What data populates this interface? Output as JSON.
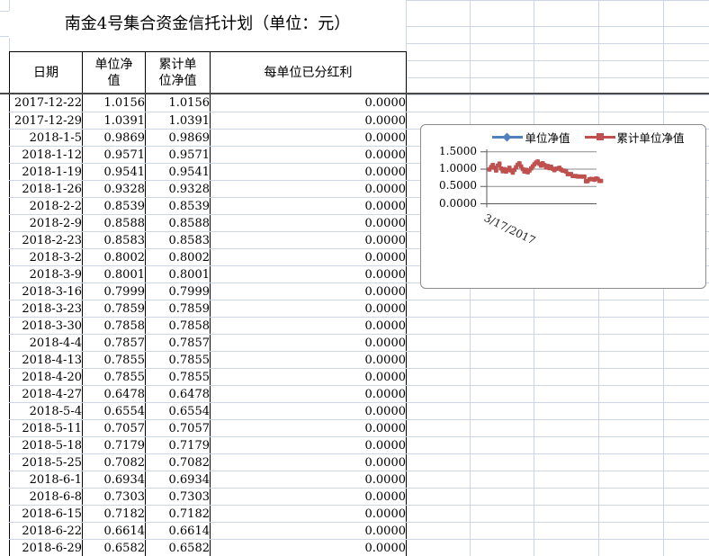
{
  "sheet": {
    "title": "南金4号集合资金信托计划（单位：元）",
    "columns": [
      "日期",
      "单位净\n值",
      "累计单\n位净值",
      "每单位已分红利"
    ],
    "rows": [
      [
        "2017-12-22",
        "1.0156",
        "1.0156",
        "0.0000"
      ],
      [
        "2017-12-29",
        "1.0391",
        "1.0391",
        "0.0000"
      ],
      [
        "2018-1-5",
        "0.9869",
        "0.9869",
        "0.0000"
      ],
      [
        "2018-1-12",
        "0.9571",
        "0.9571",
        "0.0000"
      ],
      [
        "2018-1-19",
        "0.9541",
        "0.9541",
        "0.0000"
      ],
      [
        "2018-1-26",
        "0.9328",
        "0.9328",
        "0.0000"
      ],
      [
        "2018-2-2",
        "0.8539",
        "0.8539",
        "0.0000"
      ],
      [
        "2018-2-9",
        "0.8588",
        "0.8588",
        "0.0000"
      ],
      [
        "2018-2-23",
        "0.8583",
        "0.8583",
        "0.0000"
      ],
      [
        "2018-3-2",
        "0.8002",
        "0.8002",
        "0.0000"
      ],
      [
        "2018-3-9",
        "0.8001",
        "0.8001",
        "0.0000"
      ],
      [
        "2018-3-16",
        "0.7999",
        "0.7999",
        "0.0000"
      ],
      [
        "2018-3-23",
        "0.7859",
        "0.7859",
        "0.0000"
      ],
      [
        "2018-3-30",
        "0.7858",
        "0.7858",
        "0.0000"
      ],
      [
        "2018-4-4",
        "0.7857",
        "0.7857",
        "0.0000"
      ],
      [
        "2018-4-13",
        "0.7855",
        "0.7855",
        "0.0000"
      ],
      [
        "2018-4-20",
        "0.7855",
        "0.7855",
        "0.0000"
      ],
      [
        "2018-4-27",
        "0.6478",
        "0.6478",
        "0.0000"
      ],
      [
        "2018-5-4",
        "0.6554",
        "0.6554",
        "0.0000"
      ],
      [
        "2018-5-11",
        "0.7057",
        "0.7057",
        "0.0000"
      ],
      [
        "2018-5-18",
        "0.7179",
        "0.7179",
        "0.0000"
      ],
      [
        "2018-5-25",
        "0.7082",
        "0.7082",
        "0.0000"
      ],
      [
        "2018-6-1",
        "0.6934",
        "0.6934",
        "0.0000"
      ],
      [
        "2018-6-8",
        "0.7303",
        "0.7303",
        "0.0000"
      ],
      [
        "2018-6-15",
        "0.7182",
        "0.7182",
        "0.0000"
      ],
      [
        "2018-6-22",
        "0.6614",
        "0.6614",
        "0.0000"
      ],
      [
        "2018-6-29",
        "0.6582",
        "0.6582",
        "0.0000"
      ]
    ]
  },
  "chart": {
    "legend": [
      {
        "label": "单位净值"
      },
      {
        "label": "累计单位净值"
      }
    ],
    "y_tick_labels": [
      "1.5000",
      "1.0000",
      "0.5000",
      "0.0000"
    ],
    "x_tick_label": "3/17/2017"
  },
  "chart_data": {
    "type": "line",
    "x_start_label": "3/17/2017",
    "x_frequency": "weekly",
    "ylim": [
      0,
      1.5
    ],
    "y_ticks": [
      0.0,
      0.5,
      1.0,
      1.5
    ],
    "legend_position": "top",
    "grid": true,
    "values_estimated_before_index": 41,
    "series": [
      {
        "name": "单位净值",
        "color": "#4f81bd",
        "marker": "diamond",
        "values": [
          0.99,
          1.06,
          1.12,
          1.04,
          0.96,
          1.1,
          1.16,
          1.02,
          0.94,
          1.0,
          0.93,
          0.98,
          1.04,
          0.96,
          0.9,
          0.98,
          1.06,
          1.13,
          1.17,
          1.08,
          1.0,
          0.93,
          0.98,
          0.91,
          0.96,
          1.02,
          1.08,
          1.14,
          1.19,
          1.22,
          1.15,
          1.1,
          1.17,
          1.12,
          1.05,
          1.09,
          1.03,
          1.07,
          1.01,
          0.97,
          1.01,
          1.0156,
          1.0391,
          0.9869,
          0.9571,
          0.9541,
          0.9328,
          0.8539,
          0.8588,
          0.8583,
          0.8002,
          0.8001,
          0.7999,
          0.7859,
          0.7858,
          0.7857,
          0.7855,
          0.7855,
          0.6478,
          0.6554,
          0.7057,
          0.7179,
          0.7082,
          0.6934,
          0.7303,
          0.7182,
          0.6614,
          0.6582
        ]
      },
      {
        "name": "累计单位净值",
        "color": "#c0504d",
        "marker": "square",
        "values": [
          0.99,
          1.06,
          1.12,
          1.04,
          0.96,
          1.1,
          1.16,
          1.02,
          0.94,
          1.0,
          0.93,
          0.98,
          1.04,
          0.96,
          0.9,
          0.98,
          1.06,
          1.13,
          1.17,
          1.08,
          1.0,
          0.93,
          0.98,
          0.91,
          0.96,
          1.02,
          1.08,
          1.14,
          1.19,
          1.22,
          1.15,
          1.1,
          1.17,
          1.12,
          1.05,
          1.09,
          1.03,
          1.07,
          1.01,
          0.97,
          1.01,
          1.0156,
          1.0391,
          0.9869,
          0.9571,
          0.9541,
          0.9328,
          0.8539,
          0.8588,
          0.8583,
          0.8002,
          0.8001,
          0.7999,
          0.7859,
          0.7858,
          0.7857,
          0.7855,
          0.7855,
          0.6478,
          0.6554,
          0.7057,
          0.7179,
          0.7082,
          0.6934,
          0.7303,
          0.7182,
          0.6614,
          0.6582
        ]
      }
    ]
  }
}
